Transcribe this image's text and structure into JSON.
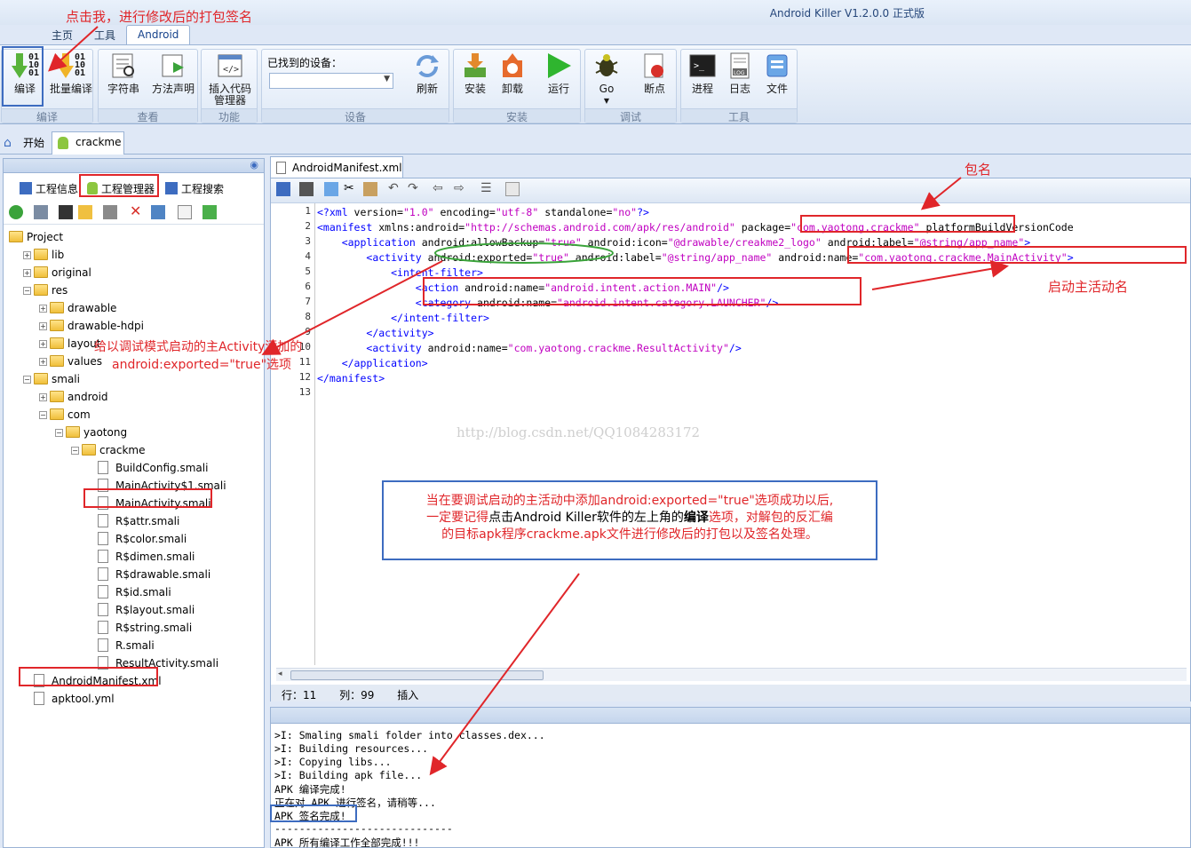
{
  "app": {
    "title": "Android Killer V1.2.0.0 正式版"
  },
  "ribbon": {
    "tabs": [
      "主页",
      "工具",
      "Android"
    ],
    "groups": {
      "compile": {
        "label": "编译",
        "buttons": [
          "编译",
          "批量编译"
        ]
      },
      "view": {
        "label": "查看",
        "buttons": [
          "字符串",
          "方法声明"
        ]
      },
      "function": {
        "label": "功能",
        "buttons": [
          "插入代码管理器"
        ]
      },
      "device": {
        "label": "设备",
        "found_label": "已找到的设备：",
        "refresh": "刷新"
      },
      "install": {
        "label": "安装",
        "buttons": [
          "安装",
          "卸载",
          "运行"
        ]
      },
      "debug": {
        "label": "调试",
        "buttons": [
          "Go",
          "断点"
        ]
      },
      "tools": {
        "label": "工具",
        "buttons": [
          "进程",
          "日志",
          "文件"
        ]
      }
    }
  },
  "doc_tabs": [
    "开始",
    "crackme"
  ],
  "left": {
    "tabs": [
      "工程信息",
      "工程管理器",
      "工程搜索"
    ],
    "tree": [
      {
        "label": "Project",
        "level": 0,
        "kind": "folder"
      },
      {
        "label": "lib",
        "level": 1,
        "kind": "folder"
      },
      {
        "label": "original",
        "level": 1,
        "kind": "folder"
      },
      {
        "label": "res",
        "level": 1,
        "kind": "folder"
      },
      {
        "label": "drawable",
        "level": 2,
        "kind": "folder"
      },
      {
        "label": "drawable-hdpi",
        "level": 2,
        "kind": "folder"
      },
      {
        "label": "layout",
        "level": 2,
        "kind": "folder"
      },
      {
        "label": "values",
        "level": 2,
        "kind": "folder"
      },
      {
        "label": "smali",
        "level": 1,
        "kind": "folder"
      },
      {
        "label": "android",
        "level": 2,
        "kind": "folder"
      },
      {
        "label": "com",
        "level": 2,
        "kind": "folder"
      },
      {
        "label": "yaotong",
        "level": 3,
        "kind": "folder"
      },
      {
        "label": "crackme",
        "level": 4,
        "kind": "folder"
      },
      {
        "label": "BuildConfig.smali",
        "level": 5,
        "kind": "file"
      },
      {
        "label": "MainActivity$1.smali",
        "level": 5,
        "kind": "file"
      },
      {
        "label": "MainActivity.smali",
        "level": 5,
        "kind": "file"
      },
      {
        "label": "R$attr.smali",
        "level": 5,
        "kind": "file"
      },
      {
        "label": "R$color.smali",
        "level": 5,
        "kind": "file"
      },
      {
        "label": "R$dimen.smali",
        "level": 5,
        "kind": "file"
      },
      {
        "label": "R$drawable.smali",
        "level": 5,
        "kind": "file"
      },
      {
        "label": "R$id.smali",
        "level": 5,
        "kind": "file"
      },
      {
        "label": "R$layout.smali",
        "level": 5,
        "kind": "file"
      },
      {
        "label": "R$string.smali",
        "level": 5,
        "kind": "file"
      },
      {
        "label": "R.smali",
        "level": 5,
        "kind": "file"
      },
      {
        "label": "ResultActivity.smali",
        "level": 5,
        "kind": "file"
      },
      {
        "label": "AndroidManifest.xml",
        "level": 1,
        "kind": "file"
      },
      {
        "label": "apktool.yml",
        "level": 1,
        "kind": "file"
      }
    ]
  },
  "editor": {
    "tab": "AndroidManifest.xml",
    "line_numbers": [
      "1",
      "2",
      "3",
      "4",
      "5",
      "6",
      "7",
      "8",
      "9",
      "10",
      "11",
      "12",
      "13"
    ],
    "lines": [
      "<?xml version=\"1.0\" encoding=\"utf-8\" standalone=\"no\"?>",
      "<manifest xmlns:android=\"http://schemas.android.com/apk/res/android\" package=\"com.yaotong.crackme\" platformBuildVersionCode",
      "    <application android:allowBackup=\"true\" android:icon=\"@drawable/creakme2_logo\" android:label=\"@string/app_name\">",
      "        <activity android:exported=\"true\" android:label=\"@string/app_name\" android:name=\"com.yaotong.crackme.MainActivity\">",
      "            <intent-filter>",
      "                <action android:name=\"android.intent.action.MAIN\"/>",
      "                <category android:name=\"android.intent.category.LAUNCHER\"/>",
      "            </intent-filter>",
      "        </activity>",
      "        <activity android:name=\"com.yaotong.crackme.ResultActivity\"/>",
      "    </application>",
      "</manifest>",
      ""
    ],
    "status": {
      "row": "行：11",
      "col": "列：99",
      "mode": "插入"
    }
  },
  "output": {
    "lines": [
      ">I: Smaling smali folder into classes.dex...",
      ">I: Building resources...",
      ">I: Copying libs...",
      ">I: Building apk file...",
      "APK 编译完成!",
      "正在对 APK 进行签名，请稍等...",
      "APK 签名完成!",
      "-----------------------------",
      "APK 所有编译工作全部完成!!!"
    ]
  },
  "annotations": {
    "top": "点击我，进行修改后的打包签名",
    "package": "包名",
    "main_activity": "启动主活动名",
    "exported_1": "给以调试模式启动的主Activity添加的",
    "exported_2": "android:exported=\"true\"选项",
    "callout_1": "当在要调试启动的主活动中添加android:exported=\"true\"选项成功以后,",
    "callout_2a": "一定要记得",
    "callout_2b": "点击Android Killer软件的左上角的",
    "callout_2c": "编译",
    "callout_2d": "选项，对解包的反汇编",
    "callout_3": "的目标apk程序crackme.apk文件进行修改后的打包以及签名处理。",
    "watermark": "http://blog.csdn.net/QQ1084283172"
  },
  "colors": {
    "annotation_red": "#e0262a",
    "annotation_blue": "#3d6cc0",
    "xml_tag": "#0000ff",
    "xml_value": "#c000c0"
  }
}
